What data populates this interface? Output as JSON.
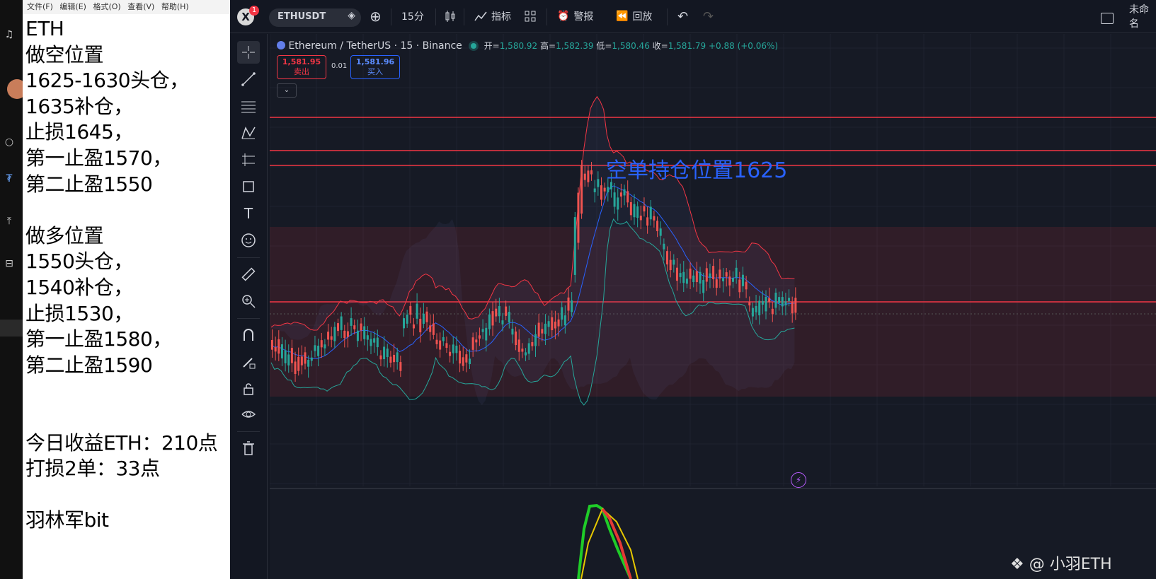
{
  "notepad": {
    "menu": [
      "文件(F)",
      "编辑(E)",
      "格式(O)",
      "查看(V)",
      "帮助(H)"
    ],
    "lines": [
      "ETH",
      "做空位置",
      "1625-1630头仓，",
      "1635补仓，",
      "止损1645，",
      "第一止盈1570，",
      "第二止盈1550",
      "",
      "做多位置",
      "1550头仓，",
      "1540补仓，",
      "止损1530，",
      "第一止盈1580，",
      "第二止盈1590",
      "",
      "",
      "今日收益ETH：210点",
      "打损2单：33点",
      "",
      "羽林军bit"
    ]
  },
  "topbar": {
    "logo_letter": "X",
    "notification_count": "1",
    "symbol": "ETHUSDT",
    "interval": "15分",
    "indicators_label": "指标",
    "alert_label": "警报",
    "replay_label": "回放",
    "layout_name": "未命名"
  },
  "legend": {
    "symbol_title": "Ethereum / TetherUS · 15 · Binance",
    "open_label": "开=",
    "open": "1,580.92",
    "high_label": "高=",
    "high": "1,582.39",
    "low_label": "低=",
    "low": "1,580.46",
    "close_label": "收=",
    "close": "1,581.79",
    "change": "+0.88 (+0.06%)",
    "sell_price": "1,581.95",
    "sell_label": "卖出",
    "spread": "0.01",
    "buy_price": "1,581.96",
    "buy_label": "买入"
  },
  "annotation": "空单持仓位置1625",
  "watermark": "@ 小羽ETH",
  "colors": {
    "bg": "#131722",
    "chart_bg": "#161a25",
    "up": "#26a69a",
    "down": "#ef5350",
    "hline": "#f23645",
    "annotation": "#2962ff",
    "band_top": "#f23645",
    "band_bottom": "#26a69a",
    "ma": "#2962ff"
  },
  "icons": [
    "cursor-icon",
    "trendline-icon",
    "fib-icon",
    "pattern-icon",
    "projection-icon",
    "shape-icon",
    "text-icon",
    "emoji-icon",
    "ruler-icon",
    "zoom-icon",
    "magnet-icon",
    "lock-draw-icon",
    "lock-icon",
    "eye-icon",
    "trash-icon"
  ]
}
